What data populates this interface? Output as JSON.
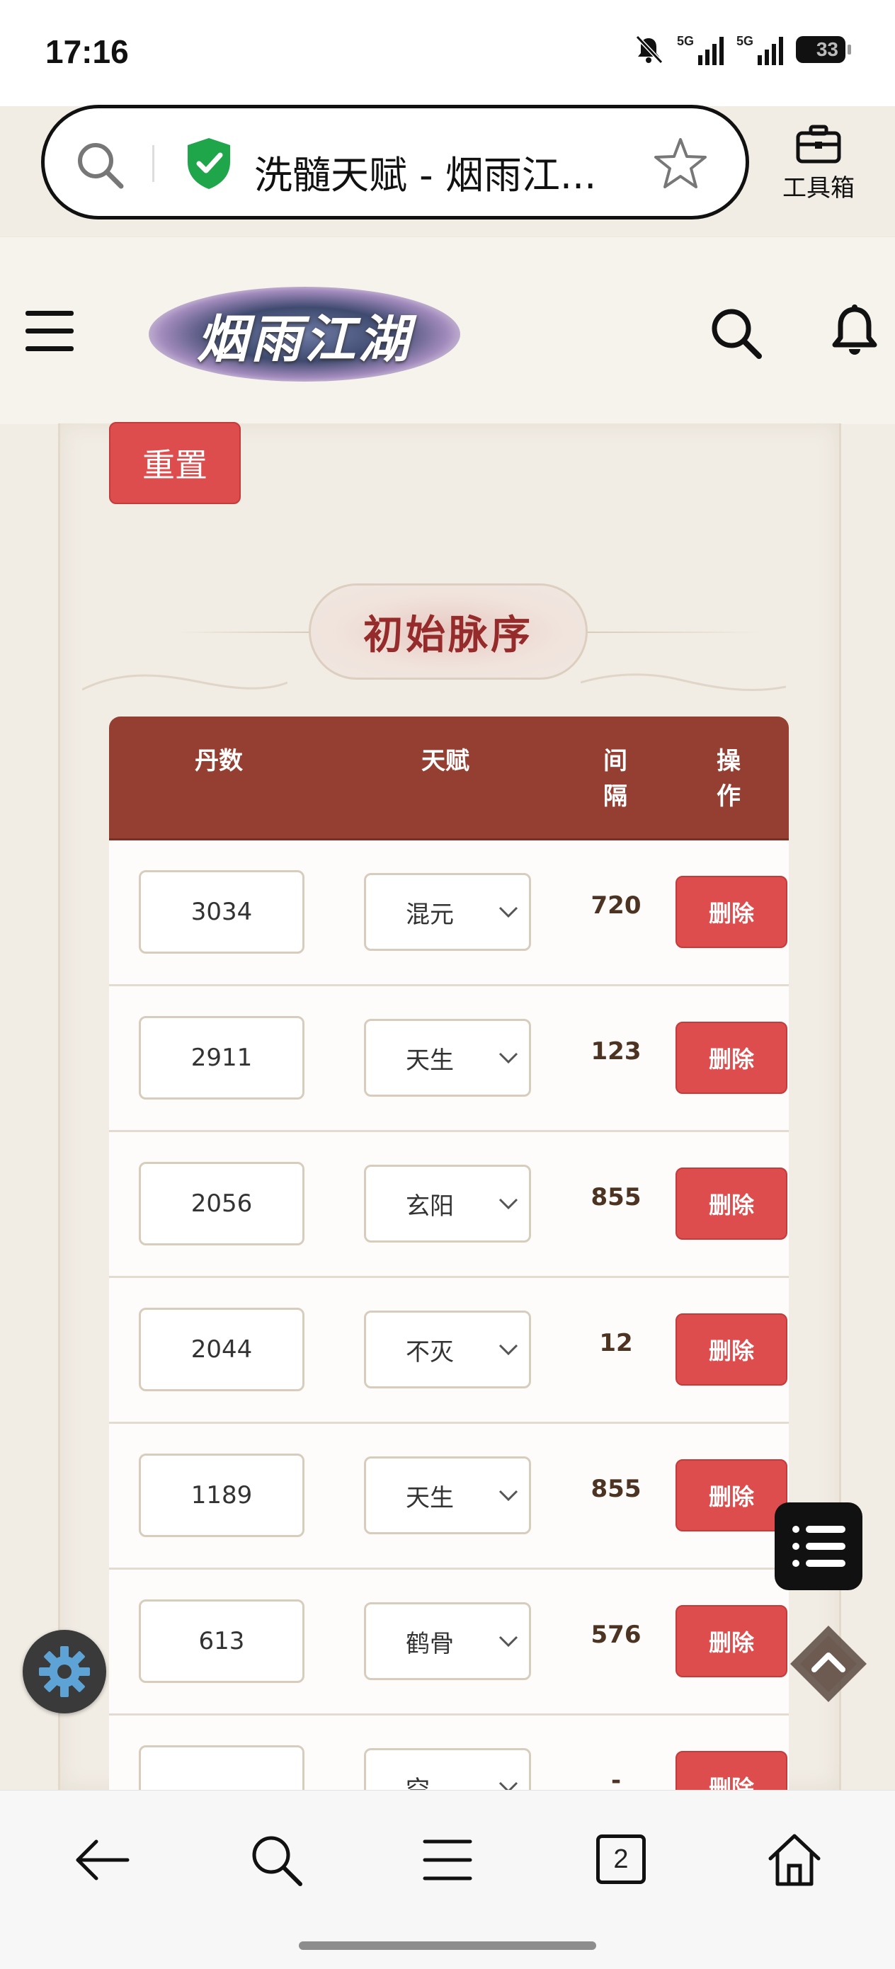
{
  "status": {
    "time": "17:16",
    "net1": "5G",
    "net2": "5G",
    "battery": "33"
  },
  "browser": {
    "tab_title": "洗髓天赋 - 烟雨江...",
    "toolbox_label": "工具箱",
    "tab_count": "2"
  },
  "site": {
    "logo_text": "烟雨江湖"
  },
  "page": {
    "reset_label": "重置",
    "section_title": "初始脉序"
  },
  "table": {
    "headers": {
      "dan": "丹数",
      "talent": "天赋",
      "interval": "间\n隔",
      "action": "操\n作"
    },
    "rows": [
      {
        "dan": "3034",
        "talent": "混元",
        "interval": "720",
        "action": "删除"
      },
      {
        "dan": "2911",
        "talent": "天生",
        "interval": "123",
        "action": "删除"
      },
      {
        "dan": "2056",
        "talent": "玄阳",
        "interval": "855",
        "action": "删除"
      },
      {
        "dan": "2044",
        "talent": "不灭",
        "interval": "12",
        "action": "删除"
      },
      {
        "dan": "1189",
        "talent": "天生",
        "interval": "855",
        "action": "删除"
      },
      {
        "dan": "613",
        "talent": "鹤骨",
        "interval": "576",
        "action": "删除"
      },
      {
        "dan": "",
        "talent": "空",
        "interval": "-",
        "action": "删除"
      }
    ]
  }
}
